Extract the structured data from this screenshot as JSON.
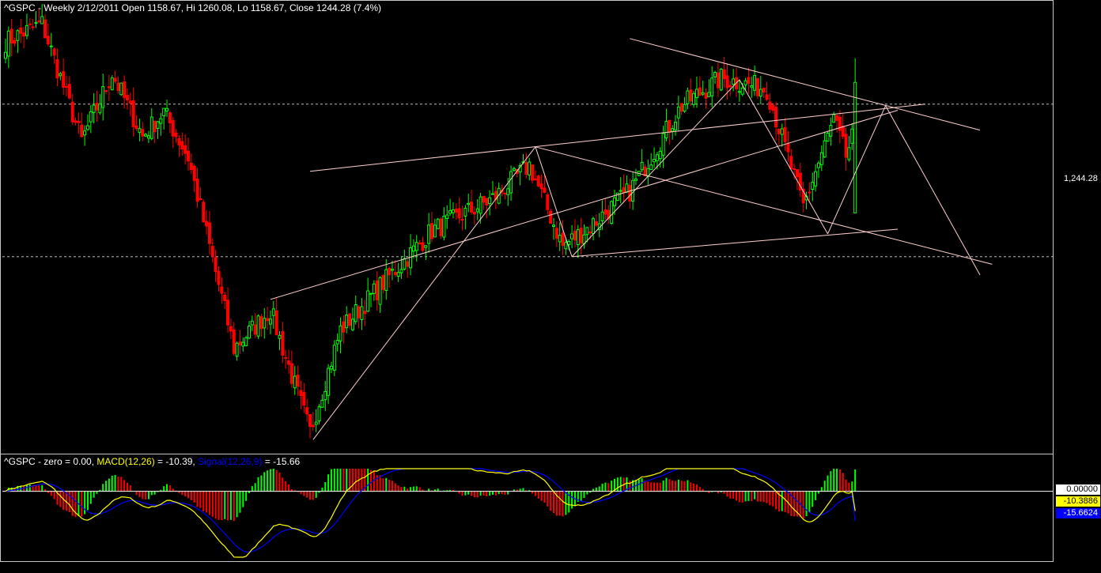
{
  "price_header": "^GSPC - Weekly 2/12/2011 Open 1158.67, Hi 1260.08, Lo 1158.67, Close 1244.28 (7.4%)",
  "last_price_label": "1,244.28",
  "macd_header": {
    "prefix": "^GSPC - zero = 0.00, ",
    "macd_name": "MACD(12,26)",
    "macd_value": " = -10.39, ",
    "signal_name": "Signal(12,26,9)",
    "signal_value": " = -15.66"
  },
  "badges": {
    "zero": "0.00000",
    "macd": "-10.3886",
    "signal": "-15.6624"
  },
  "colors": {
    "up": "#00ff00",
    "down": "#ff0000",
    "trendline": "#ffd0d0",
    "macd": "#ffff00",
    "signal": "#0000ff",
    "zero": "#ffffff"
  },
  "chart_data": [
    {
      "type": "candlestick",
      "symbol": "^GSPC",
      "interval": "Weekly",
      "last_bar": {
        "date": "2/12/2011",
        "open": 1158.67,
        "high": 1260.08,
        "low": 1158.67,
        "close": 1244.28,
        "change_pct": 7.4
      },
      "ylim": [
        1005,
        1290
      ],
      "reference_levels": [
        1230,
        1130
      ],
      "anchors": [
        {
          "i": 0,
          "v": 1271
        },
        {
          "i": 12,
          "v": 1283
        },
        {
          "i": 25,
          "v": 1206
        },
        {
          "i": 35,
          "v": 1250
        },
        {
          "i": 45,
          "v": 1209
        },
        {
          "i": 52,
          "v": 1225
        },
        {
          "i": 60,
          "v": 1195
        },
        {
          "i": 75,
          "v": 1070
        },
        {
          "i": 87,
          "v": 1095
        },
        {
          "i": 100,
          "v": 1015
        },
        {
          "i": 110,
          "v": 1082
        },
        {
          "i": 125,
          "v": 1115
        },
        {
          "i": 140,
          "v": 1147
        },
        {
          "i": 160,
          "v": 1168
        },
        {
          "i": 172,
          "v": 1190
        },
        {
          "i": 183,
          "v": 1137
        },
        {
          "i": 192,
          "v": 1150
        },
        {
          "i": 205,
          "v": 1173
        },
        {
          "i": 222,
          "v": 1229
        },
        {
          "i": 235,
          "v": 1247
        },
        {
          "i": 250,
          "v": 1240
        },
        {
          "i": 262,
          "v": 1163
        },
        {
          "i": 272,
          "v": 1220
        },
        {
          "i": 276,
          "v": 1196
        },
        {
          "i": 279,
          "v": 1213
        }
      ],
      "trendlines": [
        {
          "from": [
            87,
            1102
          ],
          "to": [
            293,
            1226
          ]
        },
        {
          "from": [
            101,
            1010
          ],
          "to": [
            174,
            1202
          ]
        },
        {
          "from": [
            174,
            1202
          ],
          "to": [
            186,
            1130
          ]
        },
        {
          "from": [
            186,
            1130
          ],
          "to": [
            241,
            1246
          ]
        },
        {
          "from": [
            241,
            1246
          ],
          "to": [
            270,
            1145
          ]
        },
        {
          "from": [
            270,
            1145
          ],
          "to": [
            289,
            1229
          ]
        },
        {
          "from": [
            289,
            1229
          ],
          "to": [
            320,
            1118
          ]
        },
        {
          "from": [
            205,
            1273
          ],
          "to": [
            320,
            1213
          ]
        },
        {
          "from": [
            174,
            1202
          ],
          "to": [
            324,
            1125
          ]
        },
        {
          "from": [
            186,
            1130
          ],
          "to": [
            293,
            1148
          ]
        },
        {
          "from": [
            100,
            1186
          ],
          "to": [
            302,
            1230
          ]
        }
      ]
    },
    {
      "type": "macd",
      "title": "^GSPC - zero = 0.00, MACD(12,26) = -10.39, Signal(12,26,9) = -15.66",
      "macd_last": -10.39,
      "signal_last": -15.66,
      "zero": 0.0,
      "ylim": [
        -35,
        12
      ]
    }
  ]
}
